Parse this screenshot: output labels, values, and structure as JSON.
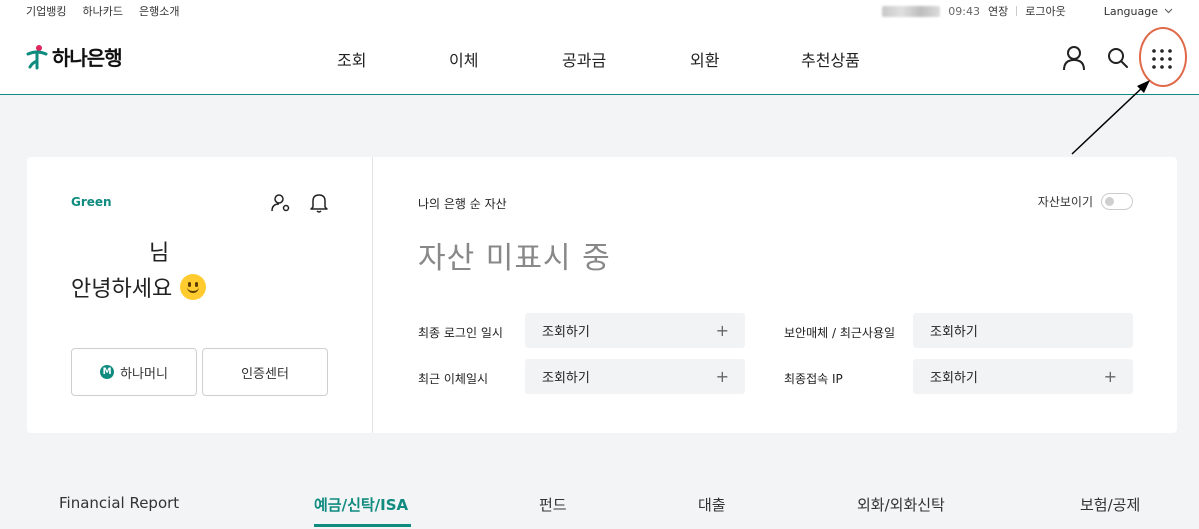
{
  "util_bar": {
    "links": [
      "기업뱅킹",
      "하나카드",
      "은행소개"
    ],
    "time": "09:43",
    "extend": "연장",
    "logout": "로그아웃",
    "language": "Language"
  },
  "header": {
    "logo_text": "하나은행",
    "nav": [
      "조회",
      "이체",
      "공과금",
      "외환",
      "추천상품"
    ]
  },
  "profile": {
    "grade": "Green",
    "name_suffix": "님",
    "greeting": "안녕하세요",
    "buttons": [
      "하나머니",
      "인증센터"
    ]
  },
  "assets": {
    "title": "나의 은행 순 자산",
    "toggle_label": "자산보이기",
    "hidden_message": "자산 미표시 중",
    "rows": [
      {
        "label": "최종 로그인 일시",
        "value": "조회하기",
        "plus": "+"
      },
      {
        "label": "보안매체 / 최근사용일",
        "value": "조회하기",
        "plus": ""
      },
      {
        "label": "최근 이체일시",
        "value": "조회하기",
        "plus": "+"
      },
      {
        "label": "최종접속 IP",
        "value": "조회하기",
        "plus": "+"
      }
    ]
  },
  "bottom_tabs": [
    "Financial Report",
    "예금/신탁/ISA",
    "펀드",
    "대출",
    "외화/외화신탁",
    "보험/공제"
  ],
  "colors": {
    "accent": "#0f8b7f",
    "highlight": "#e06a4a"
  }
}
